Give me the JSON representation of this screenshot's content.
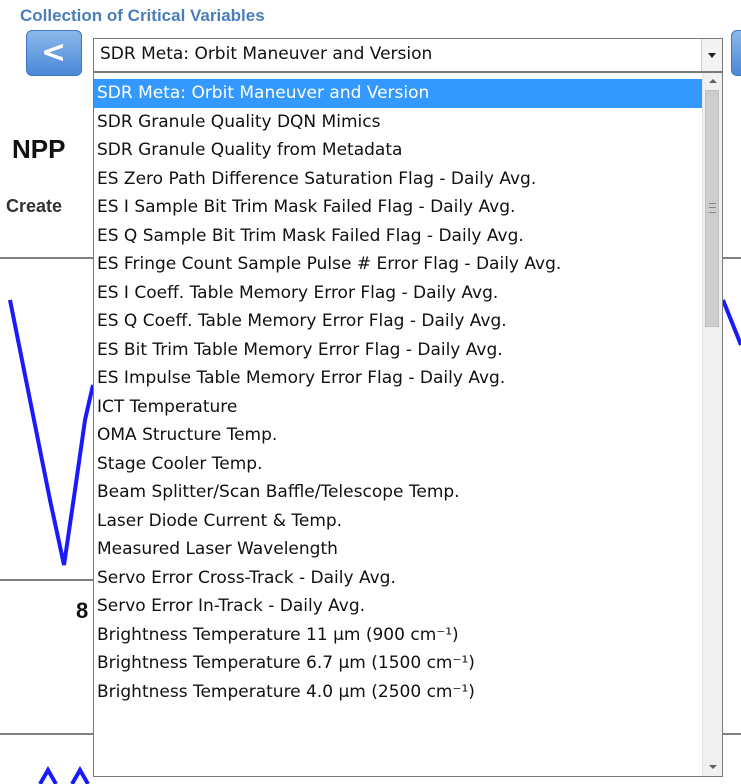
{
  "header": {
    "title": "Collection of Critical Variables",
    "back_glyph": "<"
  },
  "background": {
    "heading": "NPP",
    "subheading": "Create",
    "tick_fragment": "8",
    "line_color": "#1a1aff"
  },
  "select": {
    "value": "SDR Meta: Orbit Maneuver and Version"
  },
  "dropdown": {
    "selected_index": 0,
    "selected_color": "#3399ff",
    "options": [
      "SDR Meta: Orbit Maneuver and Version",
      "SDR Granule Quality DQN Mimics",
      "SDR Granule Quality from Metadata",
      "ES Zero Path Difference Saturation Flag - Daily Avg.",
      "ES I Sample Bit Trim Mask Failed Flag - Daily Avg.",
      "ES Q Sample Bit Trim Mask Failed Flag - Daily Avg.",
      "ES Fringe Count Sample Pulse # Error Flag - Daily Avg.",
      "ES I Coeff. Table Memory Error Flag - Daily Avg.",
      "ES Q Coeff. Table Memory Error Flag - Daily Avg.",
      "ES Bit Trim Table Memory Error Flag - Daily Avg.",
      "ES Impulse Table Memory Error Flag - Daily Avg.",
      "ICT Temperature",
      "OMA Structure Temp.",
      "Stage Cooler Temp.",
      "Beam Splitter/Scan Baffle/Telescope Temp.",
      "Laser Diode Current & Temp.",
      "Measured Laser Wavelength",
      "Servo Error Cross-Track - Daily Avg.",
      "Servo Error In-Track - Daily Avg.",
      "Brightness Temperature 11 µm (900 cm⁻¹)",
      "Brightness Temperature 6.7 µm (1500 cm⁻¹)",
      "Brightness Temperature 4.0 µm (2500 cm⁻¹)"
    ]
  }
}
